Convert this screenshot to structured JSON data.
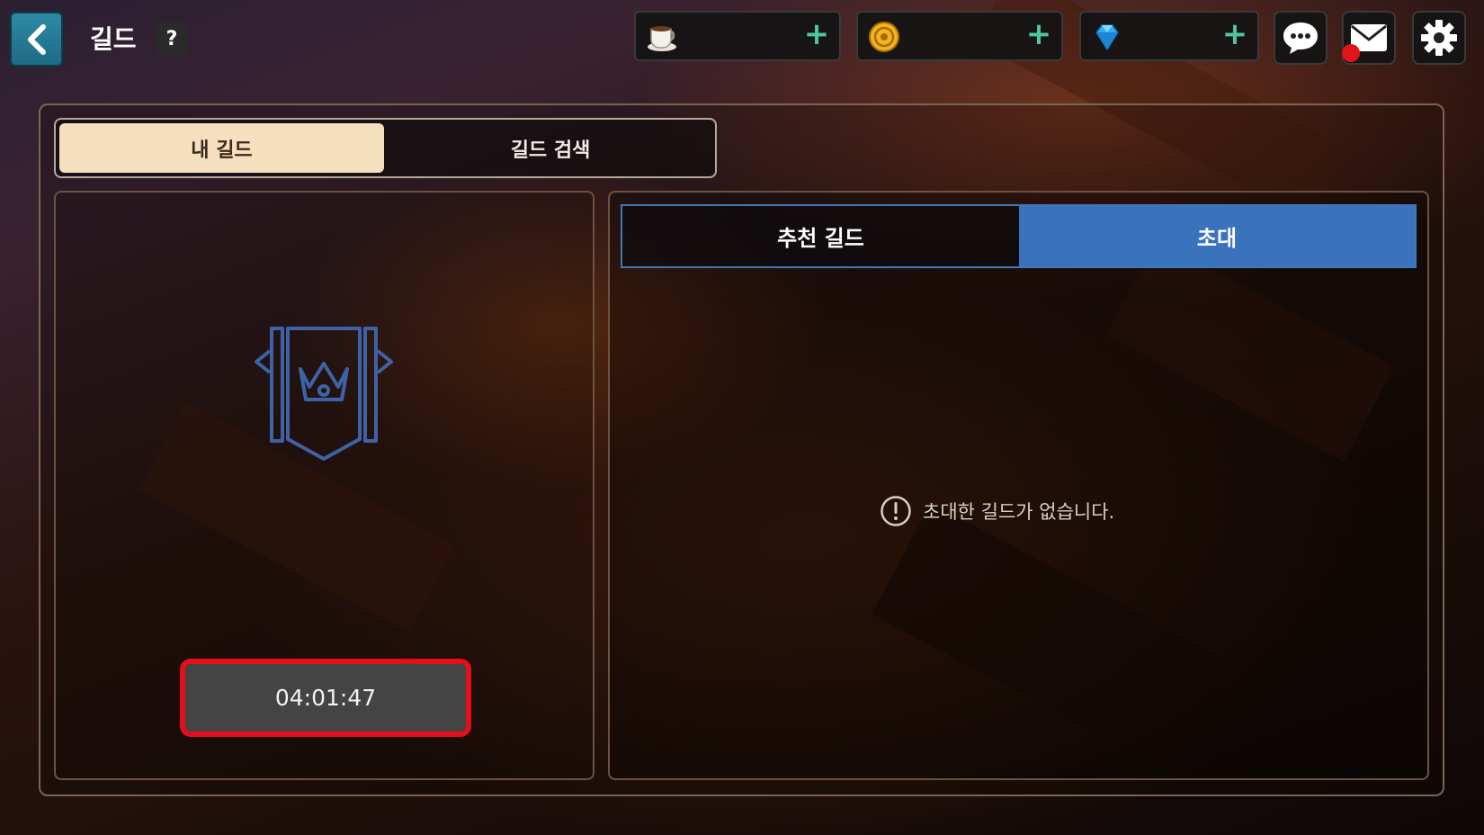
{
  "header": {
    "title": "길드",
    "help_label": "?",
    "back_icon": "chevron-left-icon"
  },
  "currencies": [
    {
      "icon": "coffee-cup-icon",
      "value": "",
      "add_label": "+"
    },
    {
      "icon": "gold-coin-icon",
      "value": "",
      "add_label": "+"
    },
    {
      "icon": "diamond-gem-icon",
      "value": "",
      "add_label": "+"
    }
  ],
  "top_icons": {
    "chat": "chat-bubble-icon",
    "mail": "mail-icon",
    "settings": "gear-icon"
  },
  "tabs": [
    {
      "label": "내 길드",
      "active": true
    },
    {
      "label": "길드 검색",
      "active": false
    }
  ],
  "my_guild": {
    "emblem": "guild-banner-crown-icon",
    "timer": "04:01:47"
  },
  "subtabs": [
    {
      "label": "추천 길드",
      "active": false
    },
    {
      "label": "초대",
      "active": true
    }
  ],
  "invite_list": {
    "empty_message": "초대한 길드가 없습니다."
  },
  "colors": {
    "accent_blue": "#3a73bb",
    "tab_active": "#f5dfbf",
    "highlight_red": "#e3101b",
    "plus_green": "#4cc7a3",
    "notification": "#e0141b"
  }
}
